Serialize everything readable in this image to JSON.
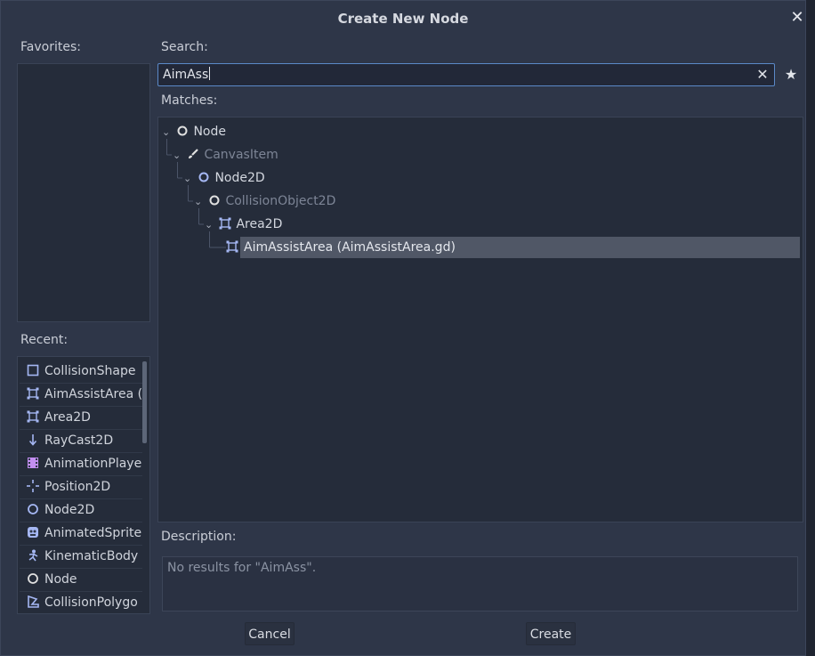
{
  "dialog": {
    "title": "Create New Node",
    "close_icon": "close-icon"
  },
  "favorites": {
    "label": "Favorites:"
  },
  "recent": {
    "label": "Recent:",
    "items": [
      {
        "label": "CollisionShape",
        "icon": "collision-shape-icon"
      },
      {
        "label": "AimAssistArea (",
        "icon": "area2d-icon"
      },
      {
        "label": "Area2D",
        "icon": "area2d-icon"
      },
      {
        "label": "RayCast2D",
        "icon": "raycast-icon"
      },
      {
        "label": "AnimationPlaye",
        "icon": "animation-player-icon"
      },
      {
        "label": "Position2D",
        "icon": "position2d-icon"
      },
      {
        "label": "Node2D",
        "icon": "node2d-icon"
      },
      {
        "label": "AnimatedSprite",
        "icon": "animated-sprite-icon"
      },
      {
        "label": "KinematicBody",
        "icon": "kinematic-body-icon"
      },
      {
        "label": "Node",
        "icon": "node-icon"
      },
      {
        "label": "CollisionPolygo",
        "icon": "collision-polygon-icon"
      }
    ]
  },
  "search": {
    "label": "Search:",
    "value": "AimAss",
    "clear_icon": "clear-icon",
    "favorite_icon": "star-icon"
  },
  "matches": {
    "label": "Matches:",
    "tree": [
      {
        "label": "Node",
        "icon": "node-icon",
        "dim": false,
        "selected": false
      },
      {
        "label": "CanvasItem",
        "icon": "brush-icon",
        "dim": true,
        "selected": false
      },
      {
        "label": "Node2D",
        "icon": "node2d-icon",
        "dim": false,
        "selected": false
      },
      {
        "label": "CollisionObject2D",
        "icon": "node-icon",
        "dim": true,
        "selected": false
      },
      {
        "label": "Area2D",
        "icon": "area2d-icon",
        "dim": false,
        "selected": false
      },
      {
        "label": "AimAssistArea (AimAssistArea.gd)",
        "icon": "area2d-icon",
        "dim": false,
        "selected": true
      }
    ]
  },
  "description": {
    "label": "Description:",
    "text": "No results for \"AimAss\"."
  },
  "buttons": {
    "cancel": "Cancel",
    "create": "Create"
  },
  "colors": {
    "accent": "#5b89c8",
    "selection": "#505766",
    "background": "#2e3648"
  }
}
